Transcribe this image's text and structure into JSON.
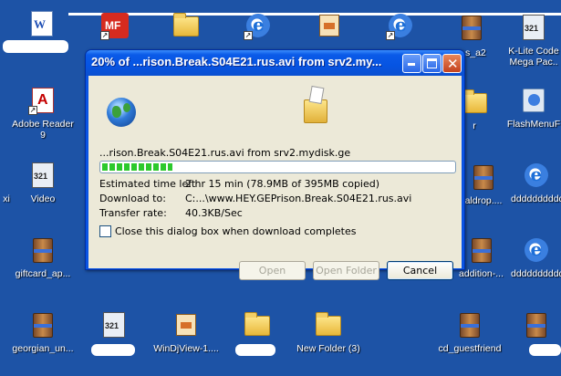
{
  "desktop": {
    "icons": [
      {
        "label": "",
        "icon": "word-doc-icon"
      },
      {
        "label": "",
        "icon": "mediafire-icon"
      },
      {
        "label": "",
        "icon": "folder-icon"
      },
      {
        "label": "",
        "icon": "internet-explorer-icon"
      },
      {
        "label": "",
        "icon": "archive-box-icon"
      },
      {
        "label": "",
        "icon": "internet-explorer-icon"
      },
      {
        "label": "s_a2",
        "icon": "winrar-icon"
      },
      {
        "label": "K-Lite Code Mega Pac..",
        "icon": "media-player-classic-icon"
      },
      {
        "label": "Adobe Reader 9",
        "icon": "adobe-reader-icon"
      },
      {
        "label": "r",
        "icon": "folder-icon"
      },
      {
        "label": "FlashMenuF",
        "icon": "flash-menu-icon"
      },
      {
        "label": "xi",
        "icon": "file-icon"
      },
      {
        "label": "Video",
        "icon": "video-file-icon"
      },
      {
        "label": "aldrop....",
        "icon": "winrar-icon"
      },
      {
        "label": "dddddddddddddd",
        "icon": "internet-explorer-icon"
      },
      {
        "label": "giftcard_ap...",
        "icon": "winrar-icon"
      },
      {
        "label": "addition-...",
        "icon": "winrar-icon"
      },
      {
        "label": "dddddddddddddd",
        "icon": "internet-explorer-icon"
      },
      {
        "label": "georgian_un...",
        "icon": "winrar-icon"
      },
      {
        "label": "",
        "icon": "video-file-icon"
      },
      {
        "label": "WinDjView-1....",
        "icon": "installer-icon"
      },
      {
        "label": "",
        "icon": "folder-icon"
      },
      {
        "label": "New Folder (3)",
        "icon": "folder-icon"
      },
      {
        "label": "cd_guestfriend",
        "icon": "winrar-icon"
      },
      {
        "label": "",
        "icon": "winrar-icon"
      }
    ]
  },
  "dialog": {
    "title": "20% of ...rison.Break.S04E21.rus.avi from srv2.my...",
    "filename_line": "...rison.Break.S04E21.rus.avi from srv2.mydisk.ge",
    "progress_percent": 20,
    "rows": [
      {
        "label": "Estimated time left",
        "value": "2 hr 15 min (78.9MB of 395MB copied)"
      },
      {
        "label": "Download to:",
        "value": "C:...\\www.HEY.GEPrison.Break.S04E21.rus.avi"
      },
      {
        "label": "Transfer rate:",
        "value": "40.3KB/Sec"
      }
    ],
    "checkbox_label": "Close this dialog box when download completes",
    "checkbox_checked": false,
    "buttons": {
      "open": "Open",
      "open_folder": "Open Folder",
      "cancel": "Cancel"
    }
  }
}
